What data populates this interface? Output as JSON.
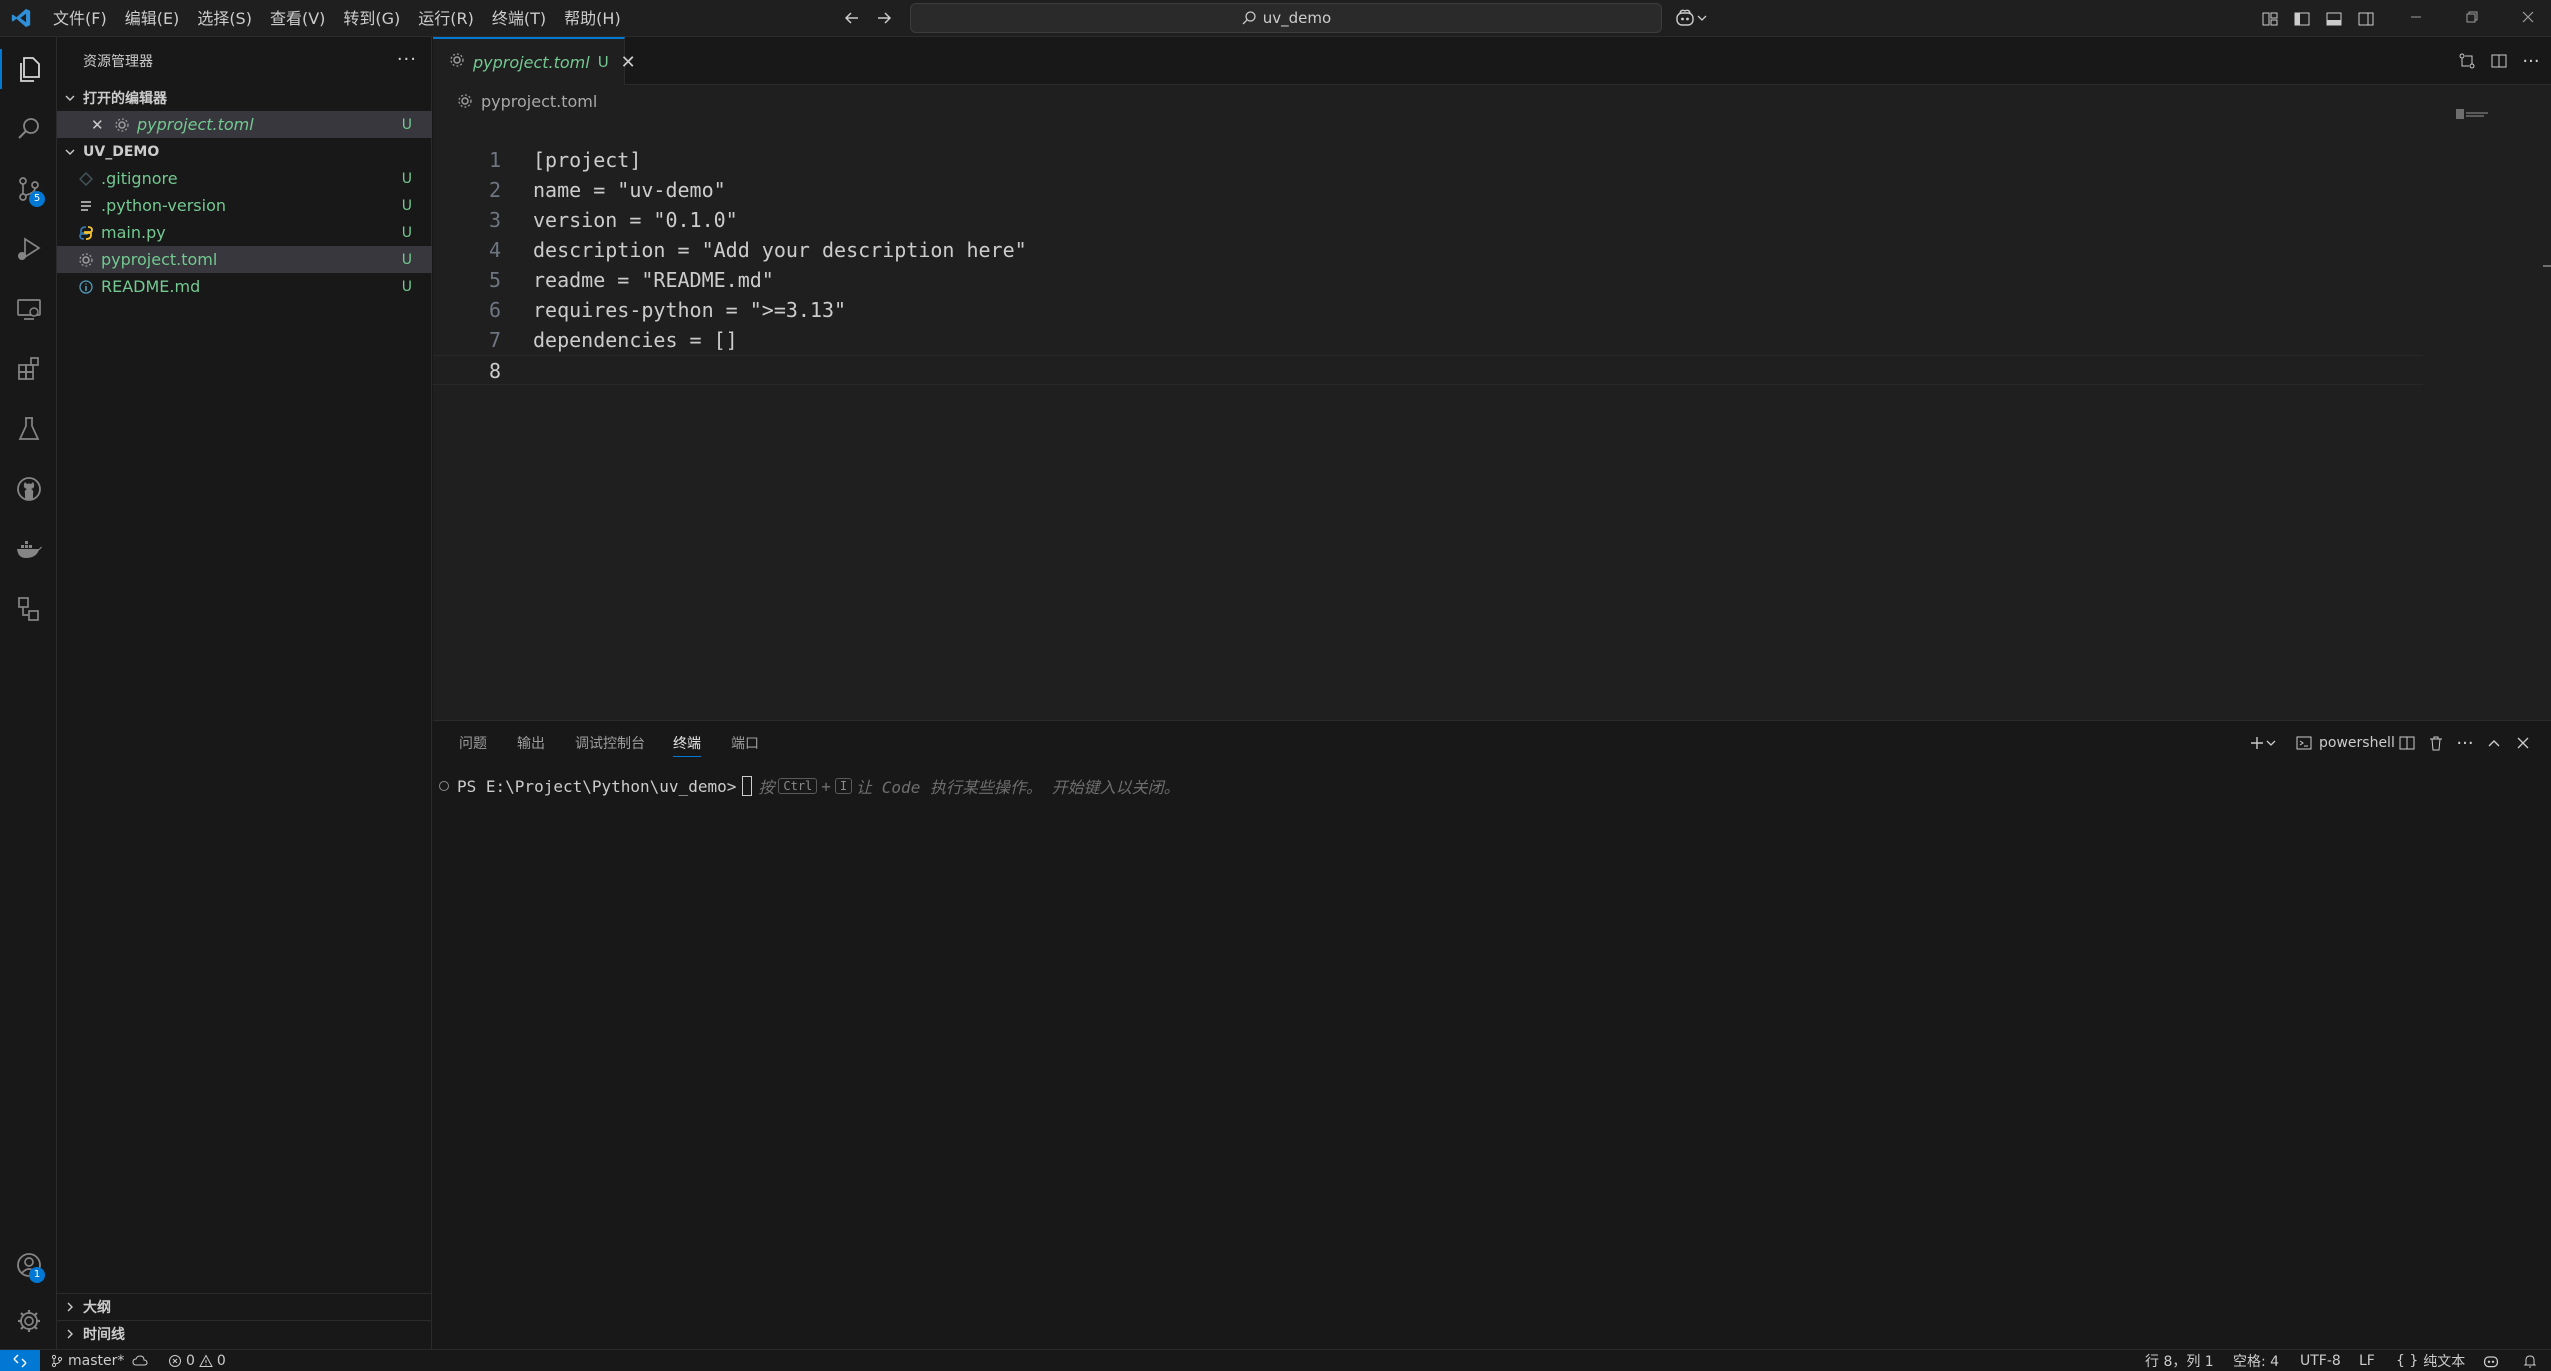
{
  "titlebar": {
    "menus": [
      "文件(F)",
      "编辑(E)",
      "选择(S)",
      "查看(V)",
      "转到(G)",
      "运行(R)",
      "终端(T)",
      "帮助(H)"
    ],
    "search_text": "uv_demo"
  },
  "activitybar": {
    "items": [
      {
        "name": "explorer",
        "active": true
      },
      {
        "name": "search"
      },
      {
        "name": "source-control",
        "badge": "5"
      },
      {
        "name": "run-and-debug"
      },
      {
        "name": "remote-explorer"
      },
      {
        "name": "extensions"
      },
      {
        "name": "testing"
      },
      {
        "name": "github"
      },
      {
        "name": "docker"
      },
      {
        "name": "project-manager"
      }
    ],
    "accounts_badge": "1"
  },
  "sidebar": {
    "title": "资源管理器",
    "open_editors": {
      "title": "打开的编辑器",
      "files": [
        {
          "name": "pyproject.toml",
          "status": "U"
        }
      ]
    },
    "workspace": {
      "title": "UV_DEMO",
      "files": [
        {
          "name": ".gitignore",
          "status": "U",
          "icon": "gitignore-icon"
        },
        {
          "name": ".python-version",
          "status": "U",
          "icon": "lines-icon"
        },
        {
          "name": "main.py",
          "status": "U",
          "icon": "python-icon"
        },
        {
          "name": "pyproject.toml",
          "status": "U",
          "icon": "gear-icon"
        },
        {
          "name": "README.md",
          "status": "U",
          "icon": "info-icon"
        }
      ]
    },
    "outline": "大纲",
    "timeline": "时间线"
  },
  "editor": {
    "tab": {
      "label": "pyproject.toml",
      "status": "U"
    },
    "breadcrumb": "pyproject.toml",
    "lines": [
      "[project]",
      "name = \"uv-demo\"",
      "version = \"0.1.0\"",
      "description = \"Add your description here\"",
      "readme = \"README.md\"",
      "requires-python = \">=3.13\"",
      "dependencies = []",
      ""
    ],
    "line_numbers": [
      "1",
      "2",
      "3",
      "4",
      "5",
      "6",
      "7",
      "8"
    ],
    "current_line": 8
  },
  "panel": {
    "tabs": [
      "问题",
      "输出",
      "调试控制台",
      "终端",
      "端口"
    ],
    "active_tab": "终端",
    "shell_label": "powershell",
    "terminal": {
      "prompt": "PS E:\\Project\\Python\\uv_demo>",
      "hint_prefix": "按",
      "hint_key1": "Ctrl",
      "hint_plus": "+",
      "hint_key2": "I",
      "hint_suffix": "让 Code 执行某些操作。 开始键入以关闭。"
    }
  },
  "statusbar": {
    "branch": "master*",
    "errors": "0",
    "warnings": "0",
    "position": "行 8，列 1",
    "spaces": "空格: 4",
    "encoding": "UTF-8",
    "eol": "LF",
    "language": "纯文本"
  },
  "colors": {
    "accent": "#0078d4",
    "untracked": "#73c991",
    "background": "#1f1f1f"
  }
}
